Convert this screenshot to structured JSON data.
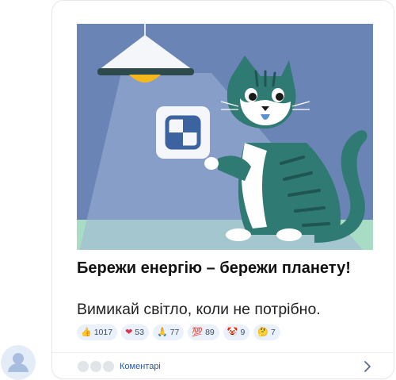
{
  "post": {
    "title": "Бережи енергію – бережи планету!",
    "text": "Вимикай світло, коли не потрібно."
  },
  "reactions": [
    {
      "icon": "thumbs-up-icon",
      "emoji": "👍",
      "count": "1017"
    },
    {
      "icon": "heart-icon",
      "emoji": "❤",
      "count": "53"
    },
    {
      "icon": "praying-hands-icon",
      "emoji": "🙏",
      "count": "77"
    },
    {
      "icon": "hundred-icon",
      "emoji": "💯",
      "count": "89"
    },
    {
      "icon": "clown-face-icon",
      "emoji": "🤡",
      "count": "9"
    },
    {
      "icon": "thinking-face-icon",
      "emoji": "🤔",
      "count": "7"
    }
  ],
  "comments": {
    "label": "Коментарі"
  },
  "colors": {
    "background": "#6a84b6",
    "floor": "#a9dcc4",
    "cat": "#2f7a72",
    "lamp_light": "#f5b81c",
    "accent_link": "#2b57a8"
  }
}
